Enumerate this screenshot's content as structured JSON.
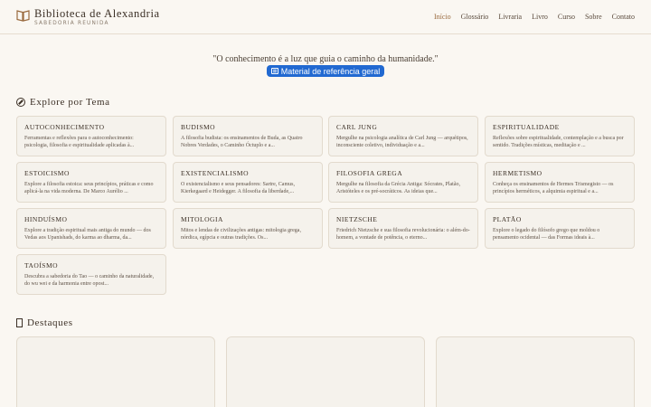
{
  "header": {
    "brand_title": "Biblioteca de Alexandria",
    "brand_subtitle": "Sabedoria Reunida",
    "logo_icon": "open-book-icon",
    "nav": [
      "Início",
      "Glossário",
      "Livraria",
      "Livro",
      "Curso",
      "Sobre",
      "Contato"
    ],
    "active_nav": "Início",
    "accent_color": "#9a6a3e"
  },
  "hero": {
    "quote": "\"O conhecimento é a luz que guia o caminho da humanidade.\"",
    "badge_label": "Material de referência geral",
    "badge_color": "#2169d1",
    "badge_icon": "book-reference-icon"
  },
  "explore": {
    "title": "Explore por Tema",
    "icon": "compass-icon",
    "topics": [
      {
        "title": "Autoconhecimento",
        "desc": "Ferramentas e reflexões para o autoconhecimento: psicologia, filosofia e espiritualidade aplicadas à..."
      },
      {
        "title": "Budismo",
        "desc": "A filosofia budista: os ensinamentos de Buda, as Quatro Nobres Verdades, o Caminho Óctuplo e a..."
      },
      {
        "title": "Carl Jung",
        "desc": "Mergulhe na psicologia analítica de Carl Jung — arquétipos, inconsciente coletivo, individuação e a..."
      },
      {
        "title": "Espiritualidade",
        "desc": "Reflexões sobre espiritualidade, contemplação e a busca por sentido. Tradições místicas, meditação e ..."
      },
      {
        "title": "Estoicismo",
        "desc": "Explore a filosofia estoica: seus princípios, práticas e como aplicá-la na vida moderna. De Marco Aurélio ..."
      },
      {
        "title": "Existencialismo",
        "desc": "O existencialismo e seus pensadores: Sartre, Camus, Kierkegaard e Heidegger. A filosofia da liberdade,..."
      },
      {
        "title": "Filosofia Grega",
        "desc": "Mergulhe na filosofia da Grécia Antiga: Sócrates, Platão, Aristóteles e os pré-socráticos. As ideias que..."
      },
      {
        "title": "Hermetismo",
        "desc": "Conheça os ensinamentos de Hermes Trismegisto — os princípios herméticos, a alquimia espiritual e a..."
      },
      {
        "title": "Hinduísmo",
        "desc": "Explore a tradição espiritual mais antiga do mundo — dos Vedas aos Upanishads, do karma ao dharma, da..."
      },
      {
        "title": "Mitologia",
        "desc": "Mitos e lendas de civilizações antigas: mitologia grega, nórdica, egípcia e outras tradições. Os..."
      },
      {
        "title": "Nietzsche",
        "desc": "Friedrich Nietzsche e sua filosofia revolucionária: o além-do-homem, a vontade de potência, o eterno..."
      },
      {
        "title": "Platão",
        "desc": "Explore o legado do filósofo grego que moldou o pensamento ocidental — das Formas ideais à..."
      },
      {
        "title": "Taoísmo",
        "desc": "Descubra a sabedoria do Tao — o caminho da naturalidade, do wu wei e da harmonia entre opost..."
      }
    ]
  },
  "highlights": {
    "title": "Destaques",
    "icon": "star-icon"
  }
}
